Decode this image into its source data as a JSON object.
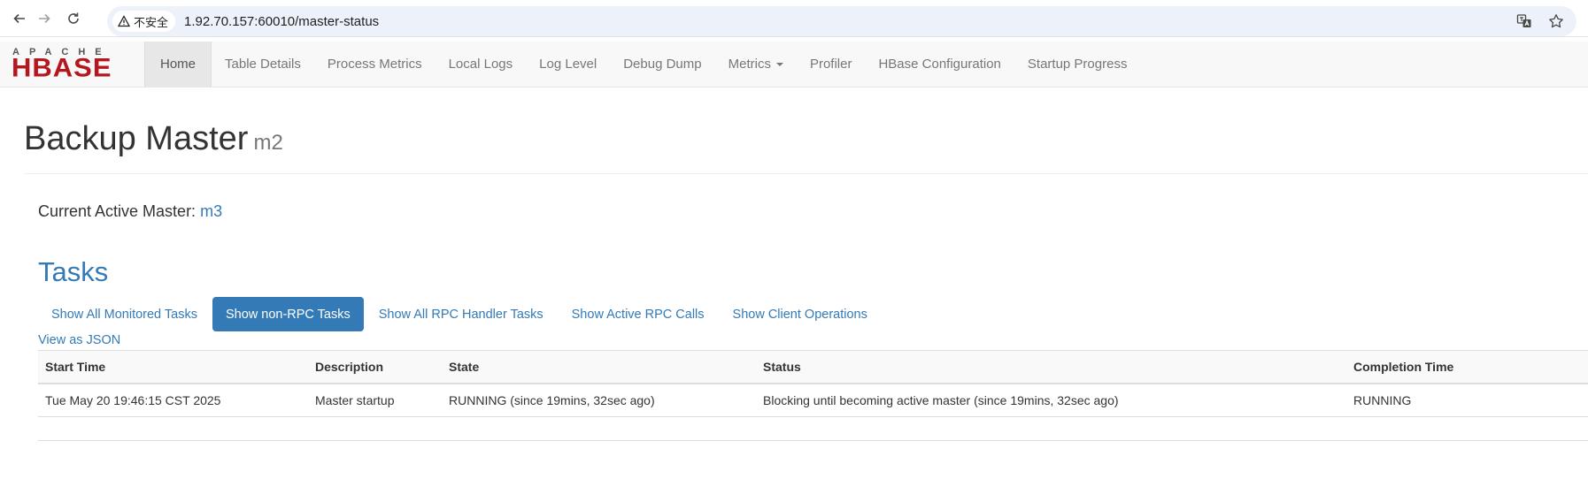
{
  "browser": {
    "security_label": "不安全",
    "url": "1.92.70.157:60010/master-status"
  },
  "navbar": {
    "logo_top": "APACHE",
    "logo_main": "HBASE",
    "items": [
      {
        "label": "Home"
      },
      {
        "label": "Table Details"
      },
      {
        "label": "Process Metrics"
      },
      {
        "label": "Local Logs"
      },
      {
        "label": "Log Level"
      },
      {
        "label": "Debug Dump"
      },
      {
        "label": "Metrics"
      },
      {
        "label": "Profiler"
      },
      {
        "label": "HBase Configuration"
      },
      {
        "label": "Startup Progress"
      }
    ],
    "active": "Home"
  },
  "header": {
    "title": "Backup Master",
    "host": "m2"
  },
  "active_master": {
    "label": "Current Active Master:",
    "host": "m3"
  },
  "tasks": {
    "title": "Tasks",
    "filters": [
      {
        "label": "Show All Monitored Tasks"
      },
      {
        "label": "Show non-RPC Tasks"
      },
      {
        "label": "Show All RPC Handler Tasks"
      },
      {
        "label": "Show Active RPC Calls"
      },
      {
        "label": "Show Client Operations"
      }
    ],
    "active_filter": "Show non-RPC Tasks",
    "json_link": "View as JSON",
    "columns": [
      "Start Time",
      "Description",
      "State",
      "Status",
      "Completion Time"
    ],
    "rows": [
      [
        "Tue May 20 19:46:15 CST 2025",
        "Master startup",
        "RUNNING (since 19mins, 32sec ago)",
        "Blocking until becoming active master (since 19mins, 32sec ago)",
        "RUNNING"
      ]
    ]
  },
  "colors": {
    "link": "#337ab7",
    "logo_red": "#b5171e",
    "navbar_bg": "#f8f8f8"
  }
}
